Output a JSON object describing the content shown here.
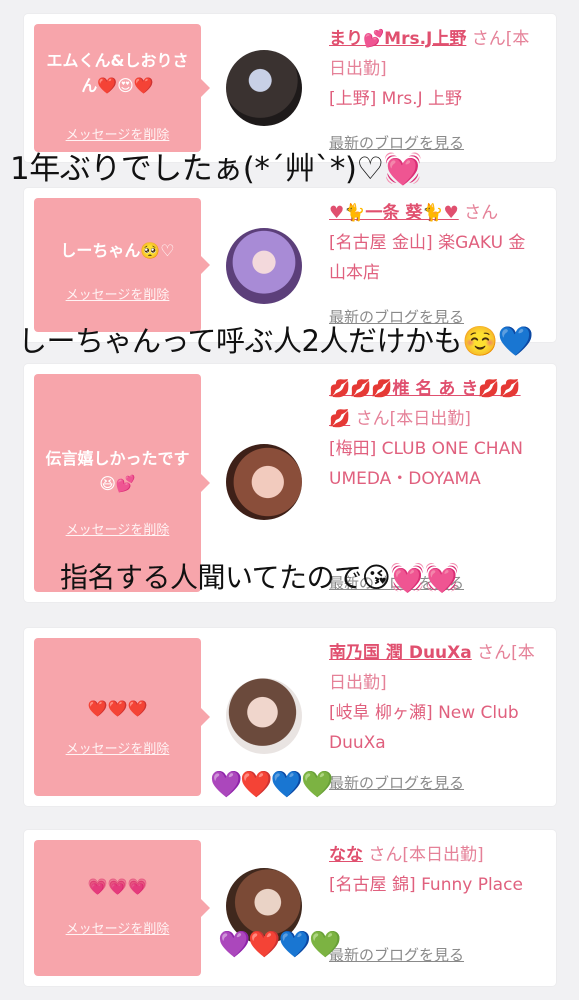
{
  "cards": [
    {
      "message": "エムくん&しおりさん❤️😍❤️",
      "delete_label": "メッセージを削除",
      "name": "まり💕Mrs.J上野",
      "suffix": "さん[本日出勤]",
      "shop": "[上野] Mrs.J 上野",
      "blog_label": "最新のブログを見る"
    },
    {
      "message": "しーちゃん🥺♡",
      "delete_label": "メッセージを削除",
      "name": "♥🐈一条 葵🐈♥",
      "suffix": "さん",
      "shop": "[名古屋 金山] 楽GAKU 金山本店",
      "blog_label": "最新のブログを見る"
    },
    {
      "message": "伝言嬉しかったです😆💕",
      "delete_label": "メッセージを削除",
      "name": "💋💋💋椎 名 あ き💋💋💋",
      "suffix": "さん[本日出勤]",
      "shop": "[梅田] CLUB ONE CHAN UMEDA・DOYAMA",
      "blog_label": "最新のブログを見る"
    },
    {
      "message": "❤️❤️❤️",
      "delete_label": "メッセージを削除",
      "name": "南乃国 潤 DuuXa",
      "suffix": "さん[本日出勤]",
      "shop": "[岐阜 柳ヶ瀬] New Club DuuXa",
      "blog_label": "最新のブログを見る"
    },
    {
      "message": "💗💗💗",
      "delete_label": "メッセージを削除",
      "name": "なな",
      "suffix": "さん[本日出勤]",
      "shop": "[名古屋 錦] Funny Place",
      "blog_label": "最新のブログを見る"
    }
  ],
  "overlays": [
    "1年ぶりでしたぁ(*´艸`*)♡💓",
    "しーちゃんって呼ぶ人2人だけかも☺️💙",
    "指名する人聞いてたので😘💓💓"
  ],
  "emoji_rows": [
    "💜❤️💙💚",
    "💜❤️💙💚"
  ],
  "colors": {
    "bubble": "#f7a5ab",
    "name": "#e0506f",
    "background": "#f1f1f3"
  }
}
